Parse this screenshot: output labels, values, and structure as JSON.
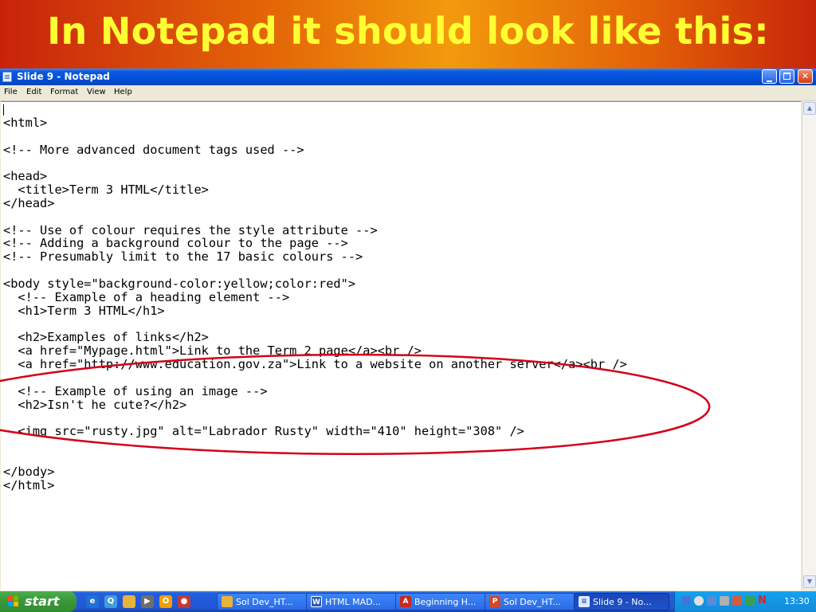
{
  "slide": {
    "title": "In Notepad it should look like this:"
  },
  "window": {
    "title": "Slide 9 - Notepad",
    "menu": [
      "File",
      "Edit",
      "Format",
      "View",
      "Help"
    ]
  },
  "code_lines": [
    "<html>",
    "",
    "<!-- More advanced document tags used -->",
    "",
    "<head>",
    "  <title>Term 3 HTML</title>",
    "</head>",
    "",
    "<!-- Use of colour requires the style attribute -->",
    "<!-- Adding a background colour to the page -->",
    "<!-- Presumably limit to the 17 basic colours -->",
    "",
    "<body style=\"background-color:yellow;color:red\">",
    "  <!-- Example of a heading element -->",
    "  <h1>Term 3 HTML</h1>",
    "",
    "  <h2>Examples of links</h2>",
    "  <a href=\"Mypage.html\">Link to the Term 2 page</a><br />",
    "  <a href=\"http://www.education.gov.za\">Link to a website on another server</a><br />",
    "",
    "  <!-- Example of using an image -->",
    "  <h2>Isn't he cute?</h2>",
    "",
    "  <img src=\"rusty.jpg\" alt=\"Labrador Rusty\" width=\"410\" height=\"308\" />",
    "",
    "",
    "</body>",
    "</html>"
  ],
  "taskbar": {
    "start_label": "start",
    "buttons": [
      {
        "label": "Sol Dev_HT...",
        "icon": "folder-icon"
      },
      {
        "label": "HTML MAD...",
        "icon": "word-icon"
      },
      {
        "label": "Beginning H...",
        "icon": "pdf-icon"
      },
      {
        "label": "Sol Dev_HT...",
        "icon": "powerpoint-icon"
      },
      {
        "label": "Slide 9 - No...",
        "icon": "notepad-icon"
      }
    ],
    "clock": "13:30"
  },
  "colors": {
    "title_text": "#ffff33",
    "annotation_ellipse": "#d4001a",
    "titlebar": "#0350d8"
  }
}
